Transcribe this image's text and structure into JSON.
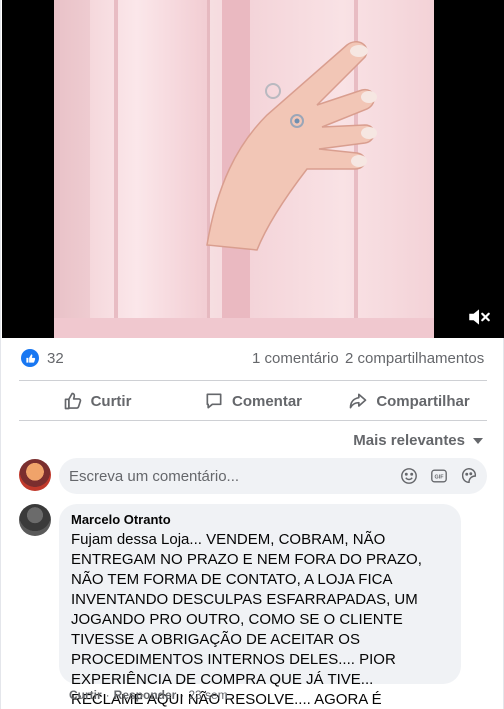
{
  "stats": {
    "likes": "32",
    "comments": "1 comentário",
    "shares": "2 compartilhamentos"
  },
  "actions": {
    "like": "Curtir",
    "comment": "Comentar",
    "share": "Compartilhar"
  },
  "sort": {
    "label": "Mais relevantes"
  },
  "composer": {
    "placeholder": "Escreva um comentário..."
  },
  "comment": {
    "author": "Marcelo Otranto",
    "text": "Fujam dessa Loja... VENDEM, COBRAM, NÃO ENTREGAM NO PRAZO E NEM FORA DO PRAZO, NÃO TEM FORMA DE CONTATO, A LOJA FICA INVENTANDO DESCULPAS ESFARRAPADAS, UM JOGANDO PRO OUTRO, COMO SE O CLIENTE TIVESSE A OBRIGAÇÃO DE ACEITAR OS PROCEDIMENTOS INTERNOS DELES.... PIOR EXPERIÊNCIA DE COMPRA QUE JÁ TIVE... RECLAME AQUI NÃO RESOLVE.... AGORA É PROCON E POLÍCIA... ABSURDO!!!",
    "like_label": "Curtir",
    "reply_label": "Responder",
    "separator": "·",
    "age": "23 sem"
  },
  "colors": {
    "facebook_blue": "#1877f2",
    "secondary_text": "#65676b",
    "bubble_bg": "#f0f2f5"
  }
}
